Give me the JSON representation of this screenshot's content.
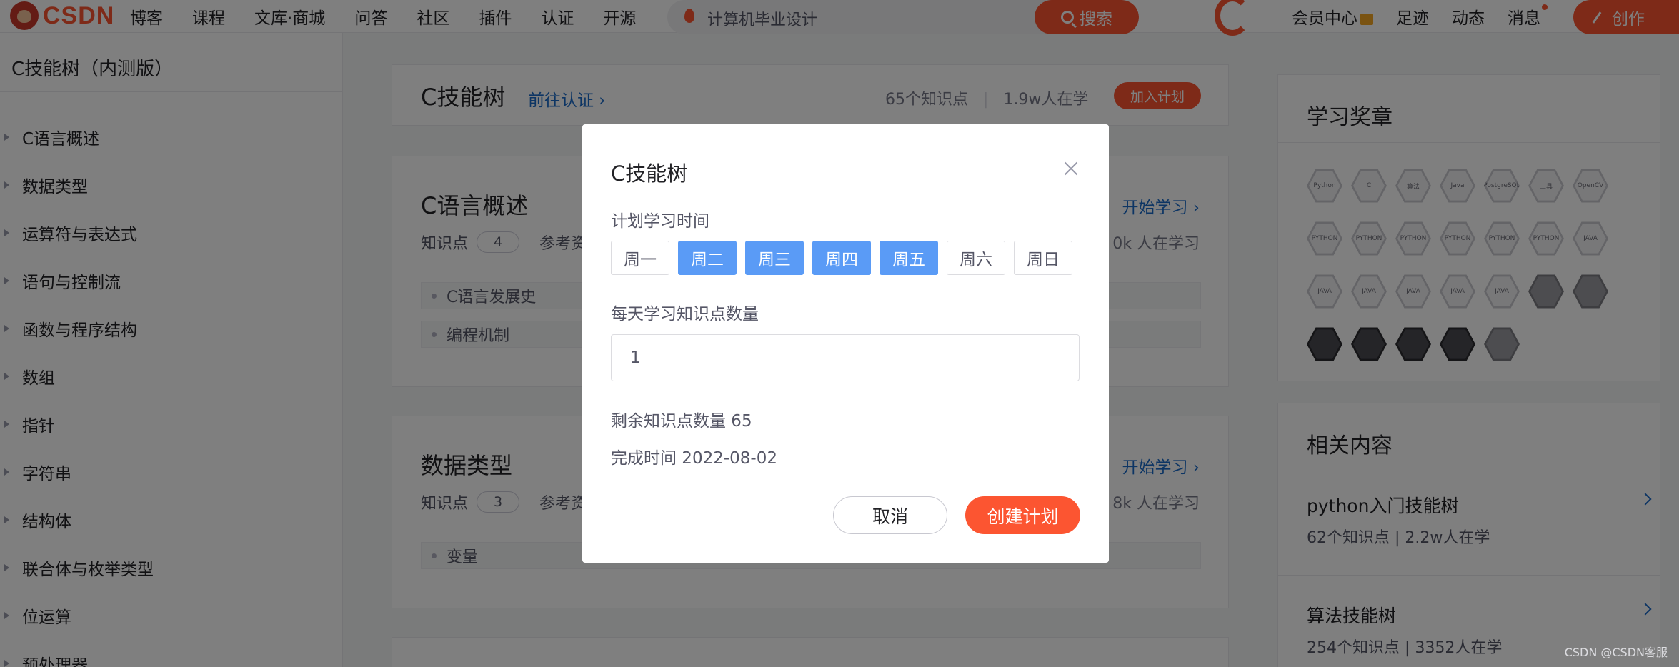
{
  "topbar": {
    "logo_text": "CSDN",
    "nav": [
      "博客",
      "课程",
      "文库·商城",
      "问答",
      "社区",
      "插件",
      "认证",
      "开源"
    ],
    "search": {
      "text": "计算机毕业设计",
      "button": "搜索"
    },
    "right_nav": {
      "member": "会员中心",
      "footprint": "足迹",
      "dynamic": "动态",
      "messages": "消息"
    },
    "create": "创作"
  },
  "sidebar": {
    "title": "C技能树（内测版）",
    "items": [
      "C语言概述",
      "数据类型",
      "运算符与表达式",
      "语句与控制流",
      "函数与程序结构",
      "数组",
      "指针",
      "字符串",
      "结构体",
      "联合体与枚举类型",
      "位运算",
      "预处理器"
    ]
  },
  "header": {
    "title": "C技能树",
    "certify_link": "前往认证 ›",
    "knowledge_count": "65个知识点",
    "learners": "1.9w人在学",
    "join_button": "加入计划"
  },
  "chapters": [
    {
      "title": "C语言概述",
      "knowledge_label": "知识点",
      "knowledge_count": "4",
      "ref_label": "参考资",
      "start": "开始学习 ›",
      "learning": "0k 人在学习",
      "items": [
        "C语言发展史",
        "编程机制"
      ]
    },
    {
      "title": "数据类型",
      "knowledge_label": "知识点",
      "knowledge_count": "3",
      "ref_label": "参考资",
      "start": "开始学习 ›",
      "learning": "8k 人在学习",
      "items": [
        "变量"
      ]
    }
  ],
  "badges_panel": {
    "title": "学习奖章",
    "badges": [
      "Python",
      "C",
      "算法",
      "Java",
      "PostgreSQL",
      "工具",
      "OpenCV",
      "PYTHON",
      "PYTHON",
      "PYTHON",
      "PYTHON",
      "PYTHON",
      "PYTHON",
      "JAVA",
      "JAVA",
      "JAVA",
      "JAVA",
      "JAVA",
      "JAVA",
      "",
      "",
      "",
      "",
      "",
      "",
      ""
    ]
  },
  "related": {
    "title": "相关内容",
    "items": [
      {
        "title": "python入门技能树",
        "stats": "62个知识点  |  2.2w人在学"
      },
      {
        "title": "算法技能树",
        "stats": "254个知识点  |  3352人在学"
      }
    ]
  },
  "modal": {
    "title": "C技能树",
    "plan_time_label": "计划学习时间",
    "days": [
      {
        "label": "周一",
        "selected": false
      },
      {
        "label": "周二",
        "selected": true
      },
      {
        "label": "周三",
        "selected": true
      },
      {
        "label": "周四",
        "selected": true
      },
      {
        "label": "周五",
        "selected": true
      },
      {
        "label": "周六",
        "selected": false
      },
      {
        "label": "周日",
        "selected": false
      }
    ],
    "daily_count_label": "每天学习知识点数量",
    "daily_count_value": "1",
    "remaining": "剩余知识点数量 65",
    "finish_time": "完成时间 2022-08-02",
    "cancel": "取消",
    "create_plan": "创建计划"
  },
  "watermark": "CSDN @CSDN客服",
  "colors": {
    "accent": "#fc5531",
    "selected_day": "#5a9bf6",
    "link": "#1a6bc8"
  }
}
